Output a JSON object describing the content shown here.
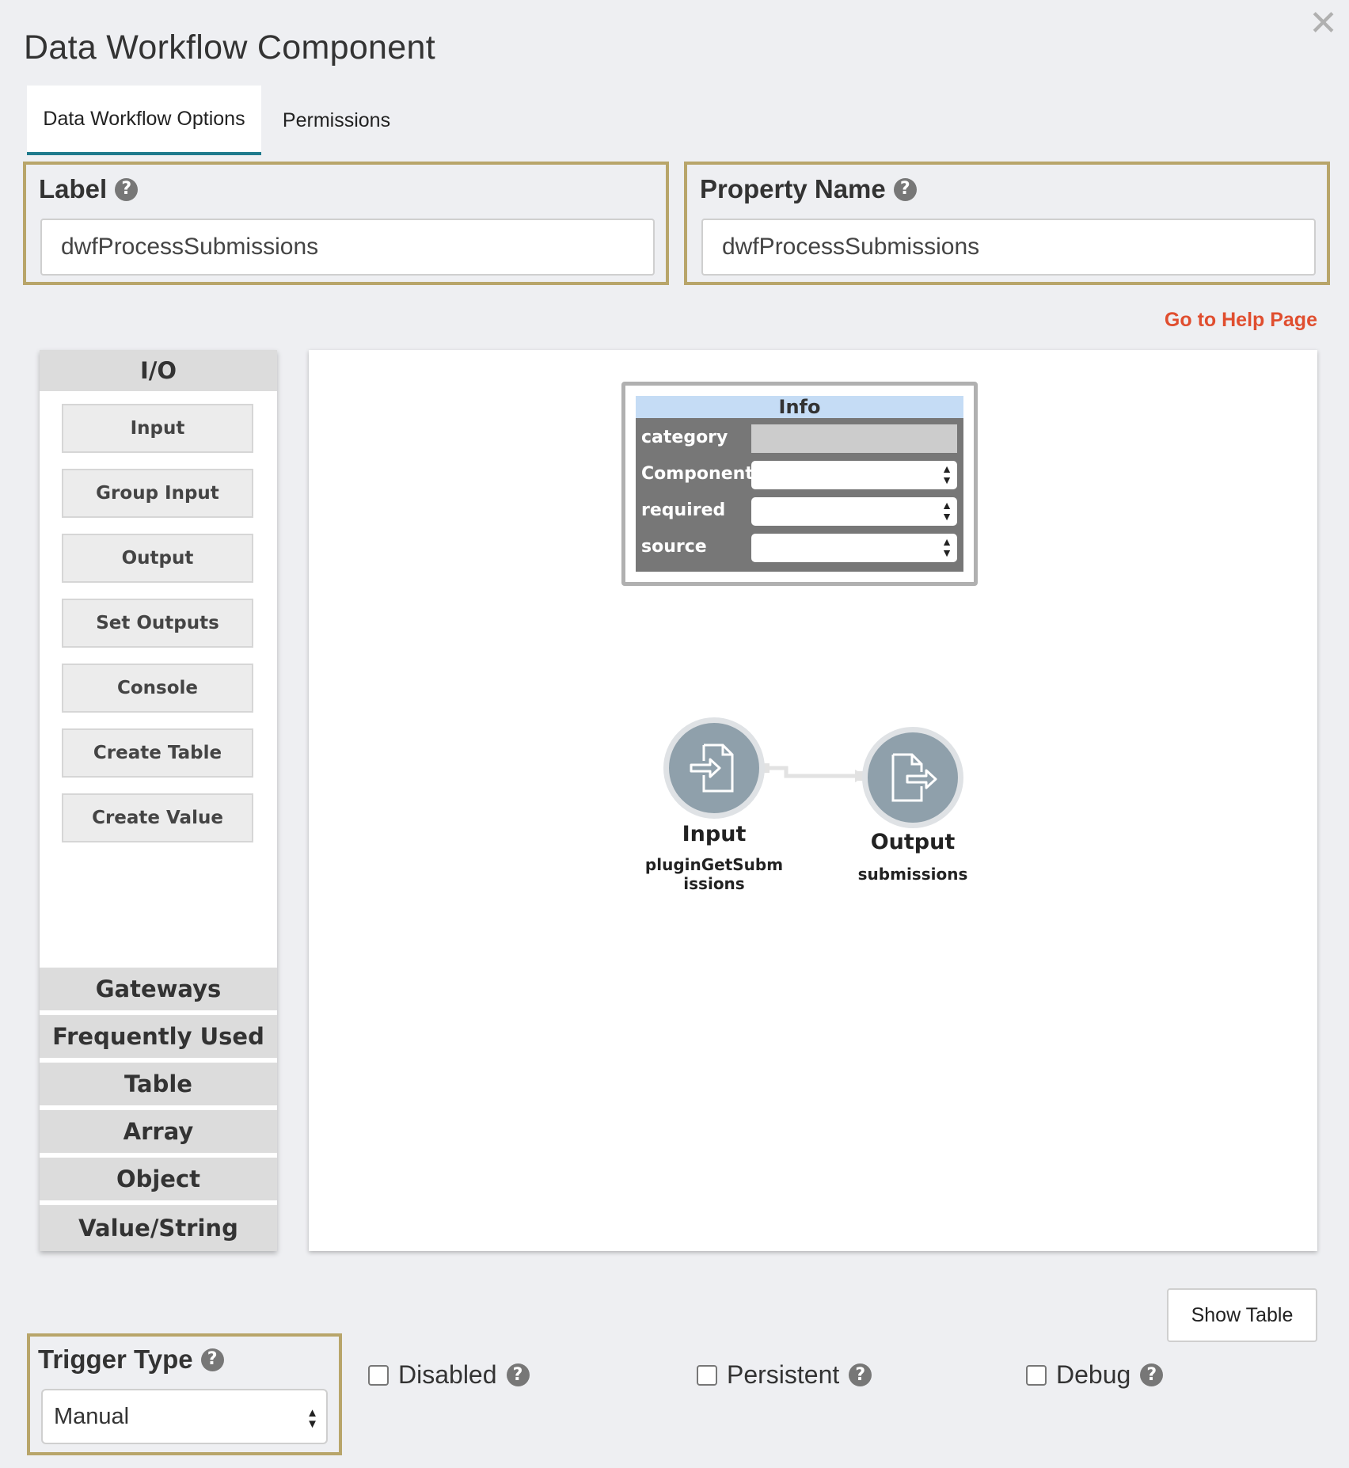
{
  "dialog": {
    "title": "Data Workflow Component",
    "close_glyph": "✕"
  },
  "tabs": [
    {
      "label": "Data Workflow Options",
      "active": true
    },
    {
      "label": "Permissions",
      "active": false
    }
  ],
  "label_field": {
    "label": "Label",
    "value": "dwfProcessSubmissions"
  },
  "property_field": {
    "label": "Property Name",
    "value": "dwfProcessSubmissions"
  },
  "help_link": "Go to Help Page",
  "palette": {
    "io_header": "I/O",
    "io_items": [
      "Input",
      "Group Input",
      "Output",
      "Set Outputs",
      "Console",
      "Create Table",
      "Create Value"
    ],
    "sections": [
      "Gateways",
      "Frequently Used",
      "Table",
      "Array",
      "Object",
      "Value/String"
    ]
  },
  "info_panel": {
    "title": "Info",
    "rows": [
      "category",
      "Component",
      "required",
      "source"
    ]
  },
  "nodes": {
    "input": {
      "title": "Input",
      "subtitle": "pluginGetSubmissions",
      "icon": "file-import-icon"
    },
    "output": {
      "title": "Output",
      "subtitle": "submissions",
      "icon": "file-export-icon"
    }
  },
  "show_table_label": "Show Table",
  "trigger": {
    "label": "Trigger Type",
    "value": "Manual"
  },
  "checkboxes": {
    "disabled": "Disabled",
    "persistent": "Persistent",
    "debug": "Debug"
  },
  "colors": {
    "accent_border": "#b8a56a",
    "tab_underline": "#1f7a8c",
    "help_link": "#e04e2f",
    "node_fill": "#8fa0ab",
    "info_header": "#c5dcf5"
  }
}
